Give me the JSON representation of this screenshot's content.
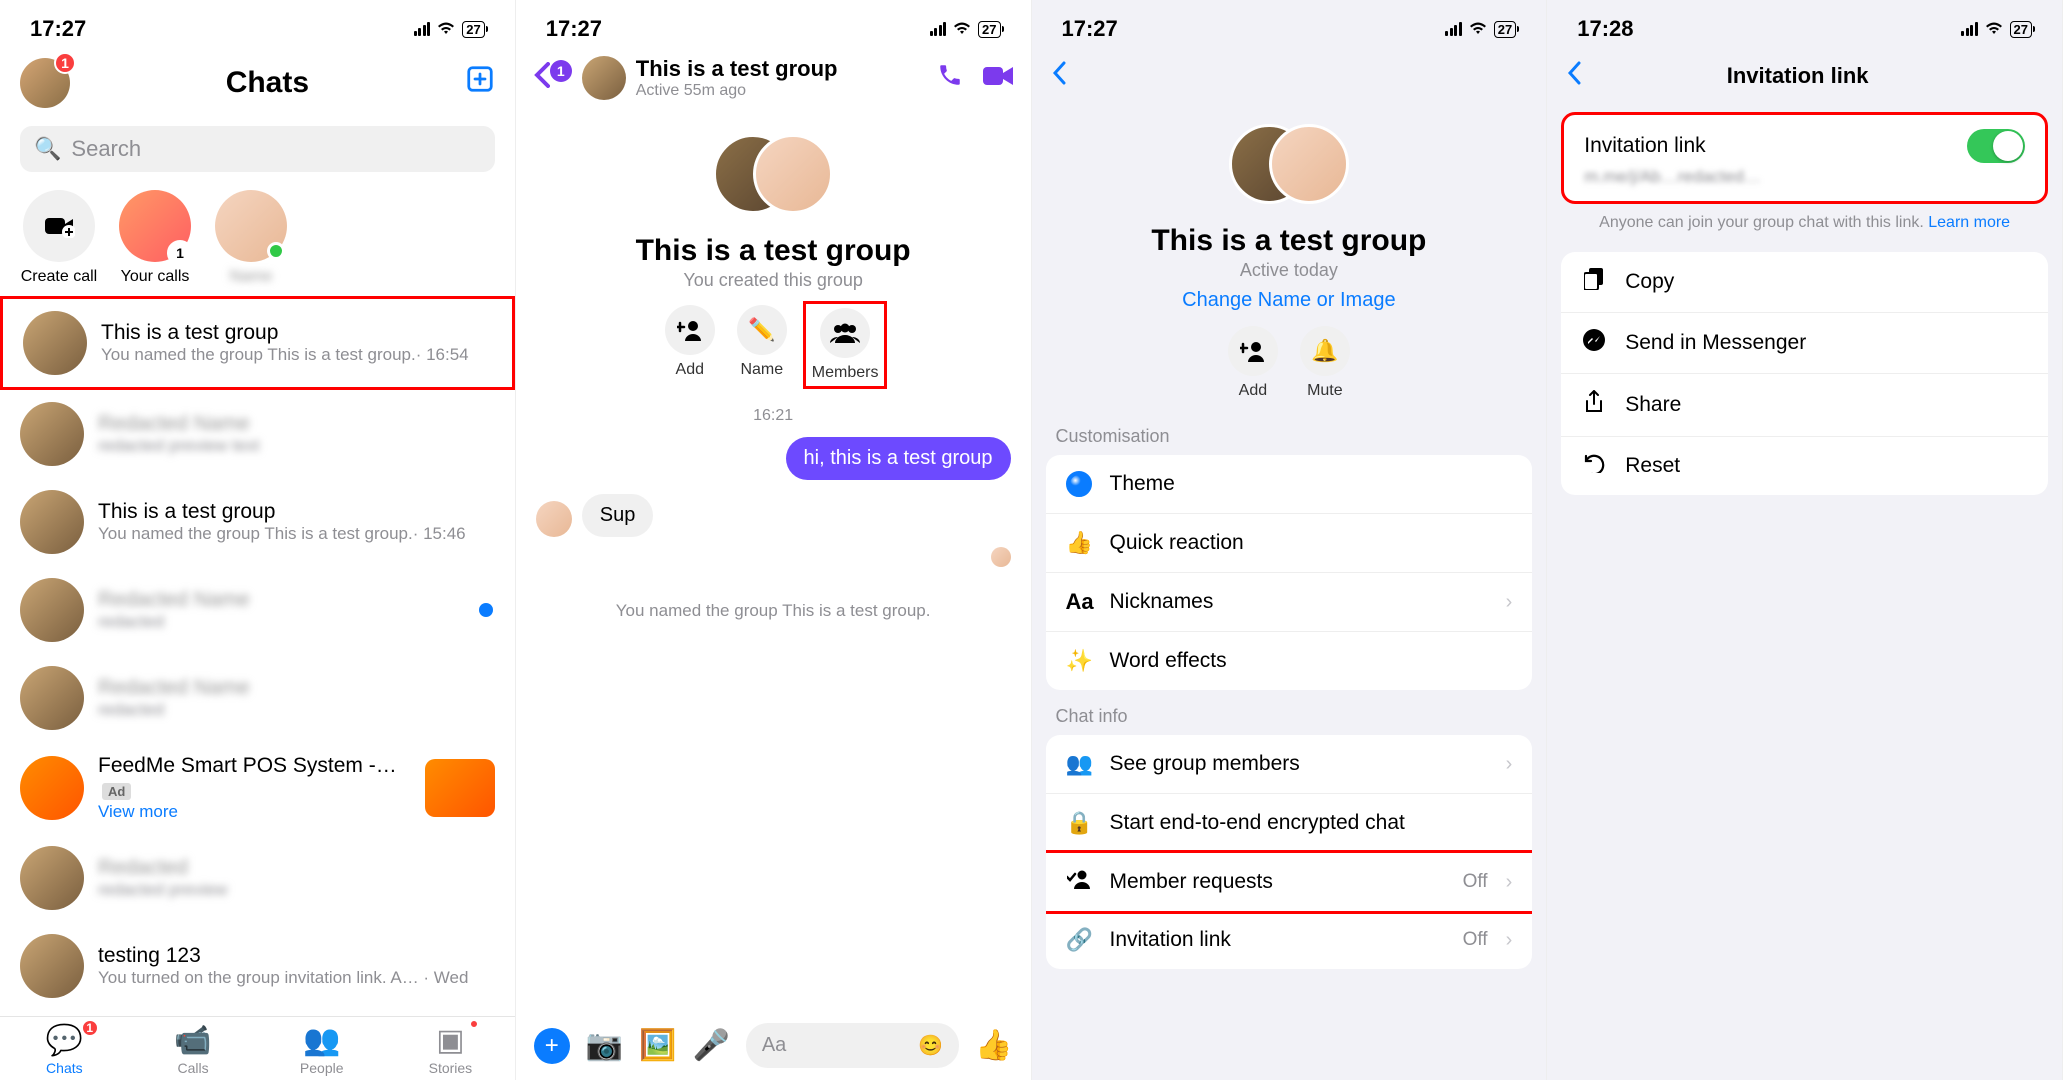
{
  "statusbar": {
    "time1": "17:27",
    "time2": "17:27",
    "time3": "17:27",
    "time4": "17:28",
    "battery": "27"
  },
  "screen1": {
    "title": "Chats",
    "badge": "1",
    "search_placeholder": "Search",
    "stories": [
      {
        "label": "Create call"
      },
      {
        "label": "Your calls"
      },
      {
        "label": ""
      }
    ],
    "chats": [
      {
        "name": "This is a test group",
        "sub": "You named the group This is a test group.· 16:54"
      },
      {
        "name": "blurred",
        "sub": "blurred text content here"
      },
      {
        "name": "This is a test group",
        "sub": "You named the group This is a test group.· 15:46"
      },
      {
        "name": "blurred",
        "sub": "blurred"
      },
      {
        "name": "blurred",
        "sub": "blurred"
      }
    ],
    "ad": {
      "title": "FeedMe Smart POS System -…",
      "tag": "Ad",
      "link": "View more"
    },
    "chat_last": {
      "name": "testing 123",
      "sub": "You turned on the group invitation link. A… · Wed"
    },
    "tabs": [
      {
        "label": "Chats",
        "badge": "1"
      },
      {
        "label": "Calls"
      },
      {
        "label": "People"
      },
      {
        "label": "Stories"
      }
    ]
  },
  "screen2": {
    "back_badge": "1",
    "title": "This is a test group",
    "sub": "Active 55m ago",
    "group_name": "This is a test group",
    "group_sub": "You created this group",
    "actions": [
      {
        "label": "Add"
      },
      {
        "label": "Name"
      },
      {
        "label": "Members"
      }
    ],
    "timestamp": "16:21",
    "msg_out": "hi, this is a test group",
    "msg_in": "Sup",
    "system": "You named the group This is a test group.",
    "composer_placeholder": "Aa"
  },
  "screen3": {
    "group_name": "This is a test group",
    "group_sub": "Active today",
    "change_link": "Change Name or Image",
    "actions": [
      {
        "label": "Add"
      },
      {
        "label": "Mute"
      }
    ],
    "section1": "Customisation",
    "rows1": [
      {
        "label": "Theme"
      },
      {
        "label": "Quick reaction"
      },
      {
        "label": "Nicknames"
      },
      {
        "label": "Word effects"
      }
    ],
    "section2": "Chat info",
    "rows2": [
      {
        "label": "See group members"
      },
      {
        "label": "Start end-to-end encrypted chat"
      },
      {
        "label": "Member requests",
        "value": "Off"
      },
      {
        "label": "Invitation link",
        "value": "Off"
      }
    ]
  },
  "screen4": {
    "title": "Invitation link",
    "toggle_label": "Invitation link",
    "url": "m.me/j/Ab…redacted…",
    "note": "Anyone can join your group chat with this link. ",
    "learn": "Learn more",
    "rows": [
      {
        "label": "Copy"
      },
      {
        "label": "Send in Messenger"
      },
      {
        "label": "Share"
      },
      {
        "label": "Reset"
      }
    ]
  }
}
